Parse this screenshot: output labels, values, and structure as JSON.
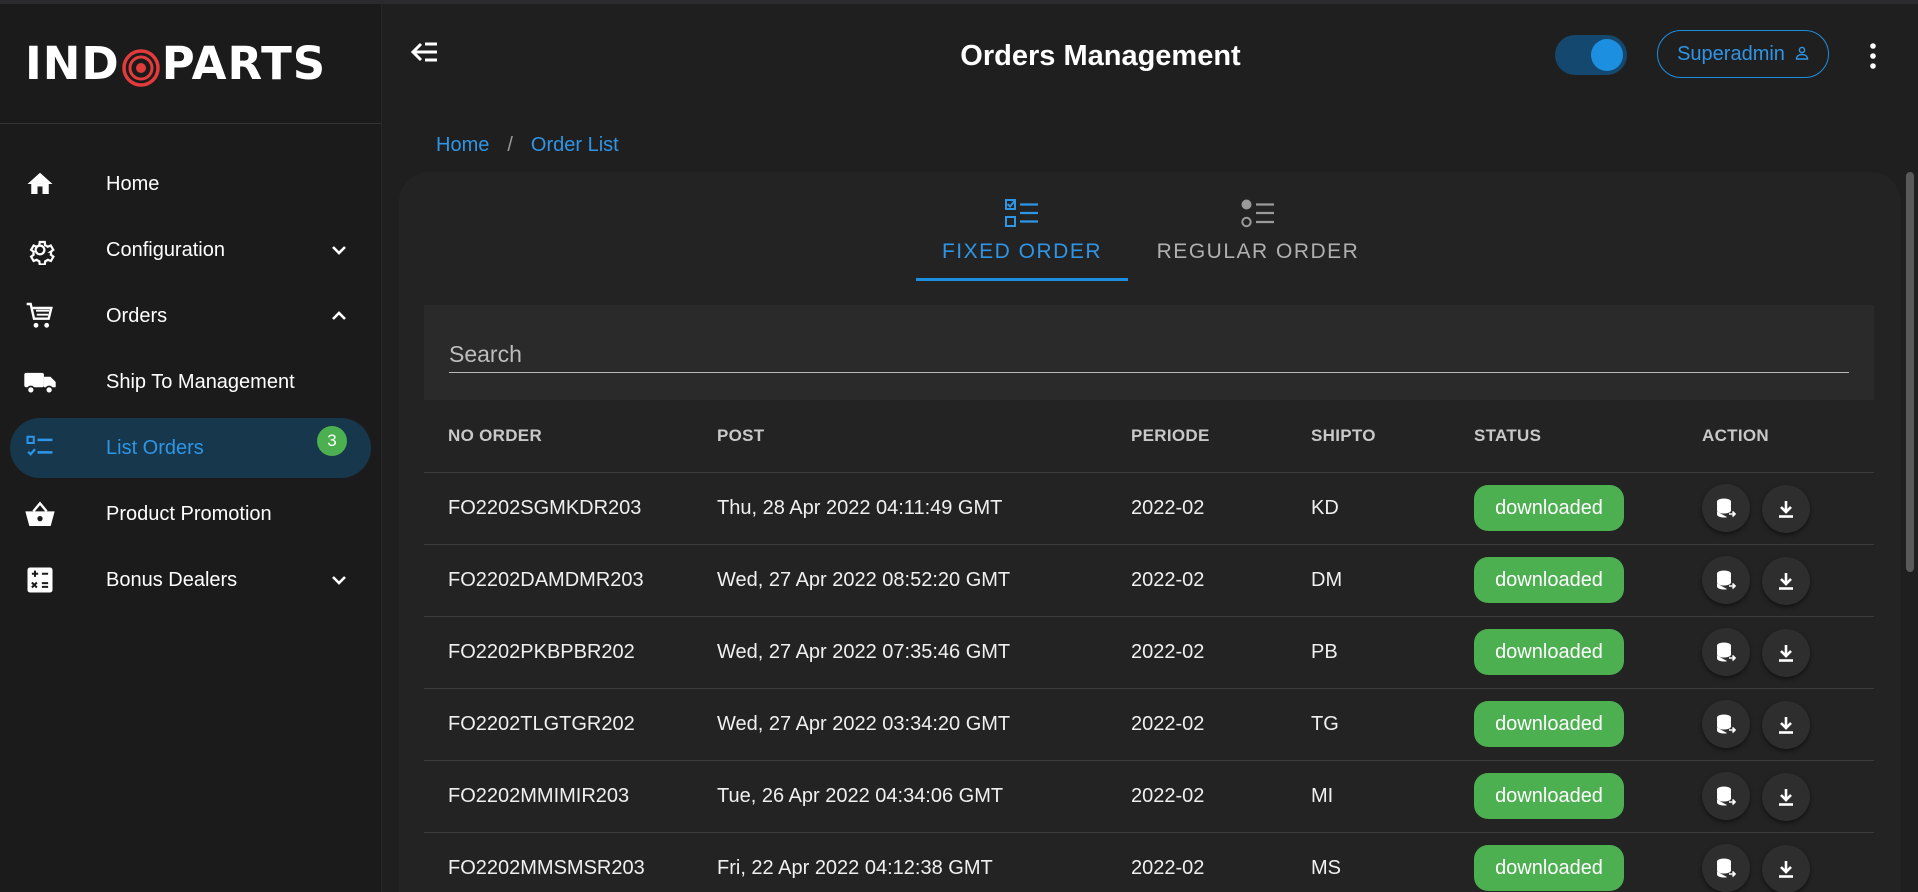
{
  "brand": {
    "logo_left": "IND",
    "logo_right": "PARTS"
  },
  "sidebar": {
    "items": [
      {
        "label": "Home",
        "icon": "home-icon"
      },
      {
        "label": "Configuration",
        "icon": "gear-icon"
      },
      {
        "label": "Orders",
        "icon": "cart-icon"
      },
      {
        "label": "Ship To Management",
        "icon": "truck-icon"
      },
      {
        "label": "List Orders",
        "icon": "checklist-icon",
        "badge": "3"
      },
      {
        "label": "Product Promotion",
        "icon": "basket-icon"
      },
      {
        "label": "Bonus Dealers",
        "icon": "calculator-icon"
      }
    ]
  },
  "header": {
    "title": "Orders Management",
    "user_label": "Superadmin"
  },
  "breadcrumb": {
    "home": "Home",
    "separator": "/",
    "current": "Order List"
  },
  "tabs": [
    {
      "label": "FIXED ORDER",
      "active": true
    },
    {
      "label": "REGULAR ORDER",
      "active": false
    }
  ],
  "search": {
    "placeholder": "Search"
  },
  "table": {
    "headers": {
      "no_order": "NO ORDER",
      "post": "POST",
      "periode": "PERIODE",
      "shipto": "SHIPTO",
      "status": "STATUS",
      "action": "ACTION"
    },
    "rows": [
      {
        "no_order": "FO2202SGMKDR203",
        "post": "Thu, 28 Apr 2022 04:11:49 GMT",
        "periode": "2022-02",
        "shipto": "KD",
        "status": "downloaded"
      },
      {
        "no_order": "FO2202DAMDMR203",
        "post": "Wed, 27 Apr 2022 08:52:20 GMT",
        "periode": "2022-02",
        "shipto": "DM",
        "status": "downloaded"
      },
      {
        "no_order": "FO2202PKBPBR202",
        "post": "Wed, 27 Apr 2022 07:35:46 GMT",
        "periode": "2022-02",
        "shipto": "PB",
        "status": "downloaded"
      },
      {
        "no_order": "FO2202TLGTGR202",
        "post": "Wed, 27 Apr 2022 03:34:20 GMT",
        "periode": "2022-02",
        "shipto": "TG",
        "status": "downloaded"
      },
      {
        "no_order": "FO2202MMIMIR203",
        "post": "Tue, 26 Apr 2022 04:34:06 GMT",
        "periode": "2022-02",
        "shipto": "MI",
        "status": "downloaded"
      },
      {
        "no_order": "FO2202MMSMSR203",
        "post": "Fri, 22 Apr 2022 04:12:38 GMT",
        "periode": "2022-02",
        "shipto": "MS",
        "status": "downloaded"
      }
    ]
  },
  "colors": {
    "accent": "#1d8fe0",
    "success": "#4caf50",
    "background": "#1f1f1f"
  }
}
